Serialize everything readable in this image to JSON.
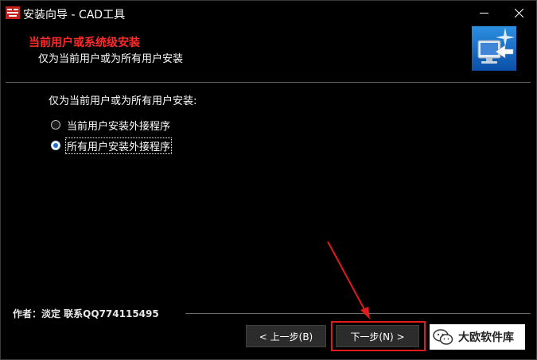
{
  "window": {
    "title": "安装向导 - CAD工具",
    "minimize_glyph": "—",
    "close_glyph": "✕"
  },
  "header": {
    "title": "当前用户或系统级安装",
    "subtitle": "仅为当前用户或为所有用户安装"
  },
  "body": {
    "question": "仅为当前用户或为所有用户安装:",
    "options": [
      {
        "label": "当前用户安装外接程序",
        "selected": false
      },
      {
        "label": "所有用户安装外接程序",
        "selected": true
      }
    ]
  },
  "footer": {
    "author": "作者：淡定  联系QQ774115495",
    "back_label": "< 上一步(B)",
    "next_label": "下一步(N) >"
  },
  "watermark": {
    "text": "大欧软件库"
  },
  "colors": {
    "header_title": "#ff2a2a",
    "highlight": "#e21b1b",
    "radio_selected": "#1e6ed6"
  }
}
